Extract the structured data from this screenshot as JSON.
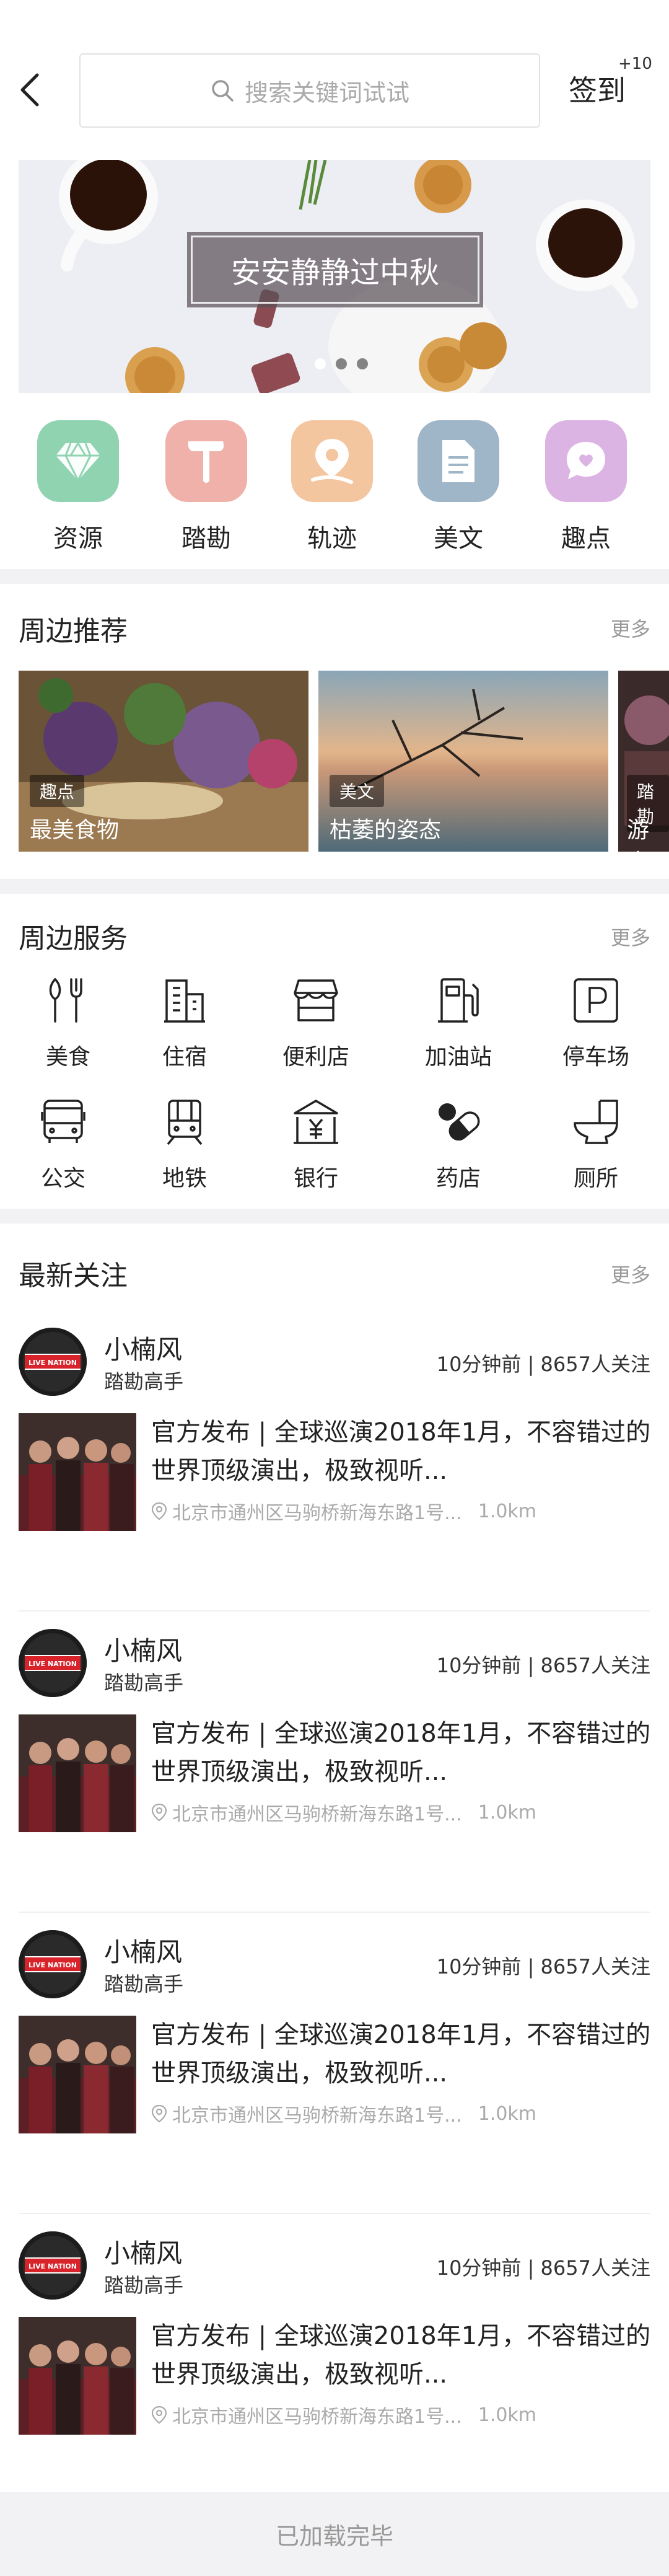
{
  "header": {
    "search_placeholder": "搜索关键词试试",
    "checkin_label": "签到",
    "checkin_badge": "+10"
  },
  "banner": {
    "title": "安安静静过中秋",
    "dots": 3,
    "active_dot": 0
  },
  "categories": [
    {
      "label": "资源",
      "icon": "diamond-icon",
      "color": "#8fd3b1"
    },
    {
      "label": "踏勘",
      "icon": "hammer-icon",
      "color": "#efb1aa"
    },
    {
      "label": "轨迹",
      "icon": "location-icon",
      "color": "#f4c6a0"
    },
    {
      "label": "美文",
      "icon": "document-icon",
      "color": "#9fb5c8"
    },
    {
      "label": "趣点",
      "icon": "heart-chat-icon",
      "color": "#dcb4e4"
    }
  ],
  "nearby": {
    "title": "周边推荐",
    "more": "更多",
    "cards": [
      {
        "tag": "趣点",
        "title": "最美食物"
      },
      {
        "tag": "美文",
        "title": "枯萎的姿态"
      },
      {
        "tag": "踏勘",
        "title": "游走"
      }
    ]
  },
  "services": {
    "title": "周边服务",
    "more": "更多",
    "items": [
      {
        "label": "美食",
        "icon": "utensils-icon"
      },
      {
        "label": "住宿",
        "icon": "building-icon"
      },
      {
        "label": "便利店",
        "icon": "store-icon"
      },
      {
        "label": "加油站",
        "icon": "fuel-icon"
      },
      {
        "label": "停车场",
        "icon": "parking-icon"
      },
      {
        "label": "公交",
        "icon": "bus-icon"
      },
      {
        "label": "地铁",
        "icon": "train-icon"
      },
      {
        "label": "银行",
        "icon": "bank-icon"
      },
      {
        "label": "药店",
        "icon": "pill-icon"
      },
      {
        "label": "厕所",
        "icon": "toilet-icon"
      }
    ]
  },
  "feed": {
    "title": "最新关注",
    "more": "更多",
    "posts": [
      {
        "user": "小楠风",
        "level": "踏勘高手",
        "meta": "10分钟前 | 8657人关注",
        "title": "官方发布 | 全球巡演2018年1月，不容错过的世界顶级演出，极致视听...",
        "location": "北京市通州区马驹桥新海东路1号...",
        "distance": "1.0km"
      },
      {
        "user": "小楠风",
        "level": "踏勘高手",
        "meta": "10分钟前 | 8657人关注",
        "title": "官方发布 | 全球巡演2018年1月，不容错过的世界顶级演出，极致视听...",
        "location": "北京市通州区马驹桥新海东路1号...",
        "distance": "1.0km"
      },
      {
        "user": "小楠风",
        "level": "踏勘高手",
        "meta": "10分钟前 | 8657人关注",
        "title": "官方发布 | 全球巡演2018年1月，不容错过的世界顶级演出，极致视听...",
        "location": "北京市通州区马驹桥新海东路1号...",
        "distance": "1.0km"
      },
      {
        "user": "小楠风",
        "level": "踏勘高手",
        "meta": "10分钟前 | 8657人关注",
        "title": "官方发布 | 全球巡演2018年1月，不容错过的世界顶级演出，极致视听...",
        "location": "北京市通州区马驹桥新海东路1号...",
        "distance": "1.0km"
      }
    ],
    "avatar_text": "LIVE NATION"
  },
  "footer": {
    "text": "已加载完毕"
  }
}
